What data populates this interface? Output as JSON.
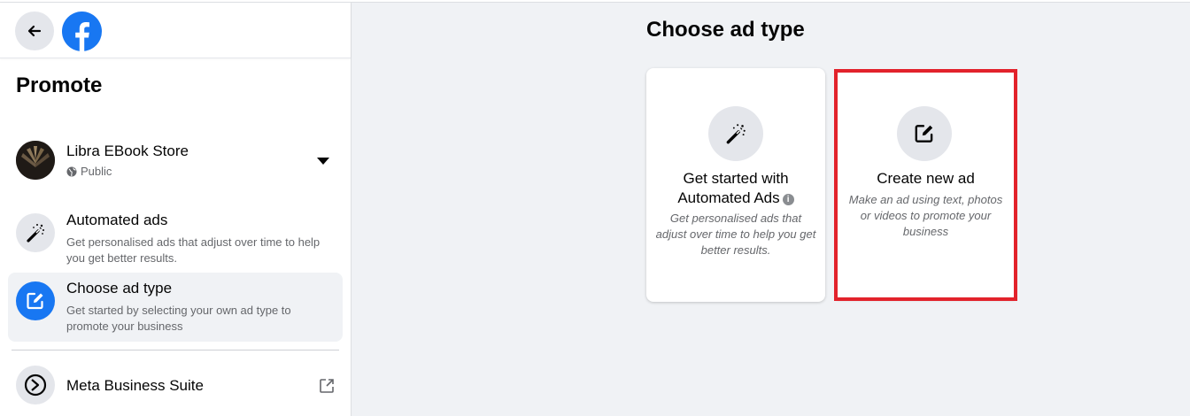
{
  "sidebar": {
    "title": "Promote",
    "page": {
      "name": "Libra EBook Store",
      "privacy": "Public"
    },
    "items": [
      {
        "title": "Automated ads",
        "description": "Get personalised ads that adjust over time to help you get better results."
      },
      {
        "title": "Choose ad type",
        "description": "Get started by selecting your own ad type to promote your business"
      }
    ],
    "business_suite": {
      "label": "Meta Business Suite"
    }
  },
  "main": {
    "title": "Choose ad type",
    "cards": [
      {
        "title": "Get started with Automated Ads",
        "description": "Get personalised ads that adjust over time to help you get better results."
      },
      {
        "title": "Create new ad",
        "description": "Make an ad using text, photos or videos to promote your business"
      }
    ]
  },
  "colors": {
    "brand_blue": "#1877f2",
    "highlight_red": "#e2222b",
    "background": "#f0f2f5"
  }
}
